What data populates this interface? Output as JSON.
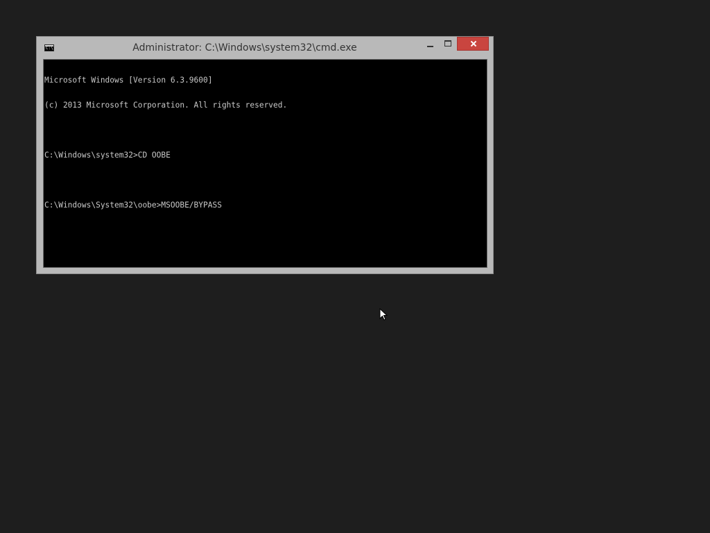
{
  "window": {
    "title": "Administrator: C:\\Windows\\system32\\cmd.exe",
    "icon": "console-icon",
    "icon_text": "C:\\."
  },
  "controls": {
    "minimize": "minimize-icon",
    "maximize": "maximize-icon",
    "close": "close-icon"
  },
  "console": {
    "lines": [
      "Microsoft Windows [Version 6.3.9600]",
      "(c) 2013 Microsoft Corporation. All rights reserved.",
      "",
      "C:\\Windows\\system32>CD OOBE",
      "",
      "C:\\Windows\\System32\\oobe>MSOOBE/BYPASS"
    ]
  },
  "colors": {
    "desktop": "#1e1e1e",
    "window_frame": "#b9b9b9",
    "close_button": "#c9453f",
    "console_bg": "#000000",
    "console_text": "#c8c8c8"
  }
}
